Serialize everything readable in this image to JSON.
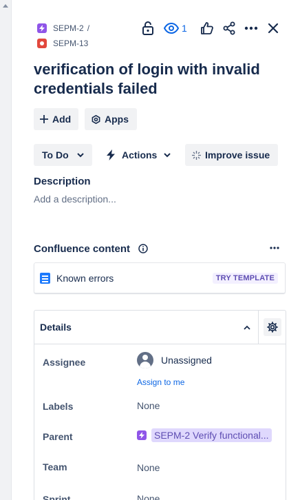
{
  "breadcrumbs": [
    {
      "key": "SEPM-2",
      "separator": "/",
      "type_icon": "epic-icon"
    },
    {
      "key": "SEPM-13",
      "type_icon": "bug-icon"
    }
  ],
  "toolbar": {
    "watch_count": "1",
    "icons": [
      "lock-icon",
      "eye-icon",
      "thumbs-up-icon",
      "share-icon",
      "more-icon",
      "close-icon"
    ]
  },
  "issue": {
    "title": "verification of login with invalid credentials failed"
  },
  "actions": {
    "add_label": "Add",
    "apps_label": "Apps",
    "status_label": "To Do",
    "actions_label": "Actions",
    "improve_label": "Improve issue"
  },
  "description": {
    "heading": "Description",
    "placeholder": "Add a description..."
  },
  "confluence": {
    "heading": "Confluence content",
    "item_name": "Known errors",
    "item_tag": "TRY TEMPLATE"
  },
  "details": {
    "heading": "Details",
    "assignee_label": "Assignee",
    "assignee_value": "Unassigned",
    "assign_to_me": "Assign to me",
    "labels_label": "Labels",
    "labels_value": "None",
    "parent_label": "Parent",
    "parent_value": "SEPM-2 Verify functional...",
    "team_label": "Team",
    "team_value": "None",
    "sprint_label": "Sprint",
    "sprint_value": "None"
  },
  "colors": {
    "accent": "#0c66e4",
    "epic": "#8f55e8",
    "bug": "#e2483d",
    "text": "#172b4d"
  }
}
